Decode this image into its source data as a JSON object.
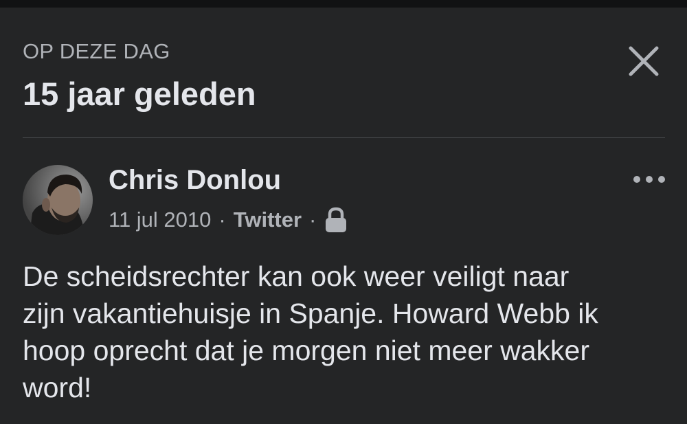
{
  "header": {
    "overline": "OP DEZE DAG",
    "title": "15 jaar geleden",
    "close_icon": "close-icon"
  },
  "post": {
    "author": "Chris Donlou",
    "date": "11 jul 2010",
    "separator": "·",
    "source": "Twitter",
    "privacy_icon": "lock-icon",
    "more_icon": "more-options-icon",
    "text": "De scheidsrechter kan ook weer veiligt naar\nzijn vakantiehuisje in Spanje. Howard Webb ik\nhoop oprecht dat je morgen niet meer wakker\nword!"
  },
  "colors": {
    "background": "#242526",
    "top_bar": "#111213",
    "primary_text": "#e4e6eb",
    "secondary_text": "#b0b3b8",
    "divider": "#4a4c4f"
  }
}
